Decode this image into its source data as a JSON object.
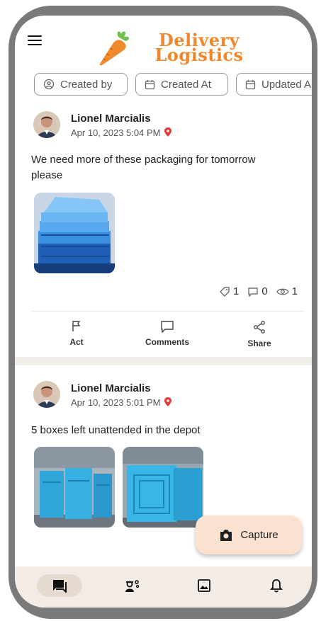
{
  "app": {
    "logo_line1": "Delivery",
    "logo_line2": "Logistics",
    "brand_color": "#f0882b",
    "fab_color": "#fbe1cf",
    "nav_bg": "#f3ece6"
  },
  "filters": [
    {
      "label": "Created by",
      "icon": "user-circle-icon"
    },
    {
      "label": "Created At",
      "icon": "calendar-icon"
    },
    {
      "label": "Updated A",
      "icon": "calendar-icon"
    }
  ],
  "posts": [
    {
      "author": "Lionel Marcialis",
      "date": "Apr 10, 2023 5:04 PM",
      "text": "We need more of these packaging for tomorrow please",
      "tags": "1",
      "comments": "0",
      "views": "1"
    },
    {
      "author": "Lionel Marcialis",
      "date": "Apr 10, 2023 5:01 PM",
      "text": "5 boxes left unattended in the depot"
    }
  ],
  "actions": {
    "act": "Act",
    "comments": "Comments",
    "share": "Share"
  },
  "fab": {
    "label": "Capture"
  },
  "nav": [
    "chat-icon",
    "engineer-icon",
    "image-icon",
    "bell-icon"
  ]
}
